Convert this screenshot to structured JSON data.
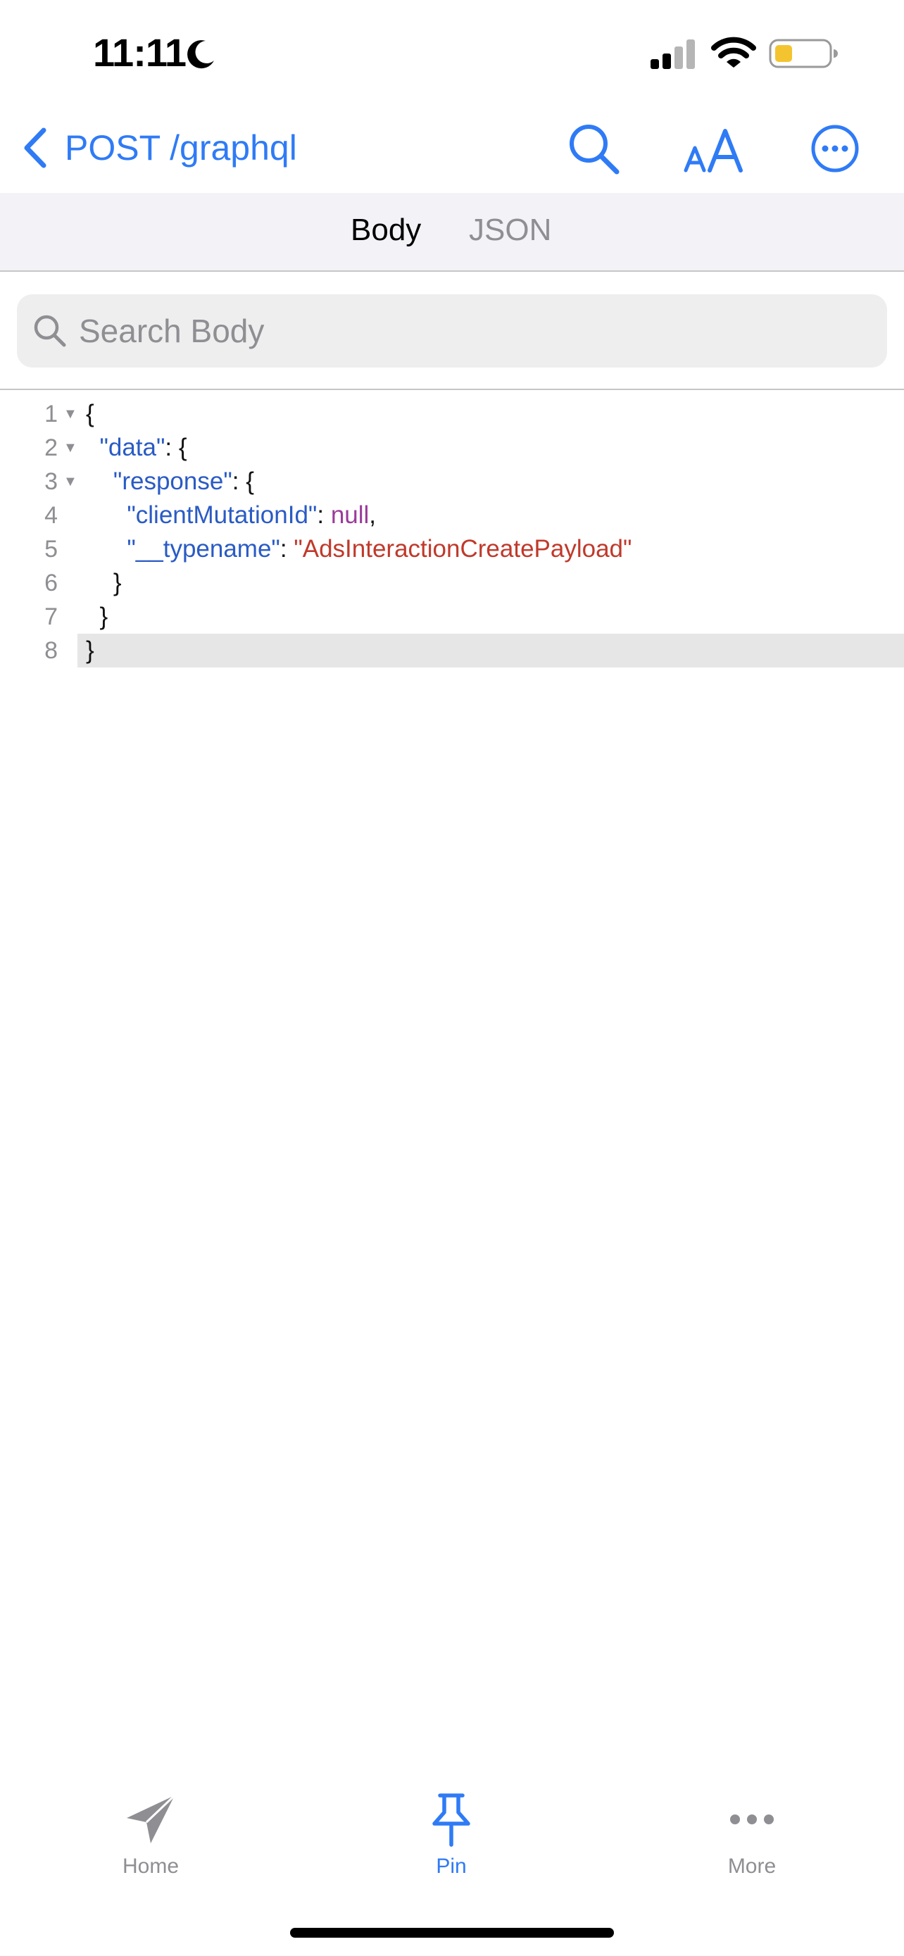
{
  "status_bar": {
    "time": "11:11",
    "icons": [
      "moon-icon",
      "signal-icon",
      "wifi-icon",
      "battery-icon"
    ],
    "battery_color": "#f4c430"
  },
  "nav": {
    "back_icon": "chevron-left-icon",
    "title": "POST /graphql",
    "actions": [
      "search-icon",
      "text-size-icon",
      "ellipsis-circle-icon"
    ],
    "accent_color": "#2f7bf6"
  },
  "tabs": {
    "items": [
      {
        "label": "Body",
        "selected": true
      },
      {
        "label": "JSON",
        "selected": false
      }
    ]
  },
  "search": {
    "placeholder": "Search Body",
    "value": ""
  },
  "code": {
    "lines": [
      {
        "num": "1",
        "text": "{"
      },
      {
        "num": "2",
        "key": "\"data\"",
        "rest": ": {"
      },
      {
        "num": "3",
        "key": "\"response\"",
        "rest": ": {"
      },
      {
        "num": "4",
        "key": "\"clientMutationId\"",
        "sep": ": ",
        "value": "null",
        "rest": ","
      },
      {
        "num": "5",
        "key": "\"__typename\"",
        "sep": ": ",
        "value": "\"AdsInteractionCreatePayload\""
      },
      {
        "num": "6",
        "text": "}"
      },
      {
        "num": "7",
        "text": "}"
      },
      {
        "num": "8",
        "text": "}"
      }
    ]
  },
  "tab_bar": {
    "items": [
      {
        "label": "Home",
        "icon": "paper-plane-icon",
        "selected": false
      },
      {
        "label": "Pin",
        "icon": "pin-icon",
        "selected": true
      },
      {
        "label": "More",
        "icon": "ellipsis-icon",
        "selected": false
      }
    ]
  }
}
